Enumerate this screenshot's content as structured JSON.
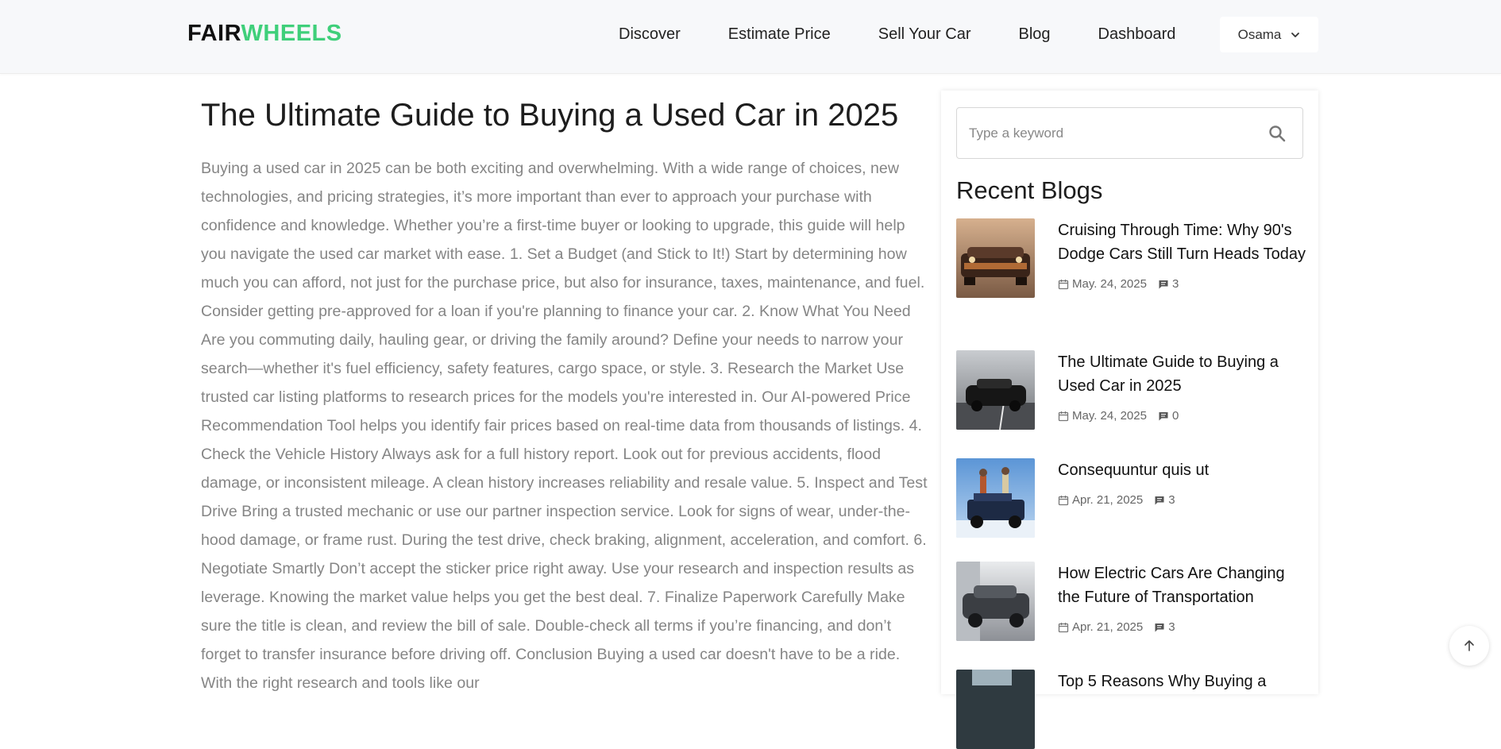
{
  "header": {
    "logo_part1": "FAIR",
    "logo_part2": "WHEELS",
    "nav": [
      "Discover",
      "Estimate Price",
      "Sell Your Car",
      "Blog",
      "Dashboard"
    ],
    "user_name": "Osama"
  },
  "article": {
    "title": "The Ultimate Guide to Buying a Used Car in 2025",
    "body": "Buying a used car in 2025 can be both exciting and overwhelming. With a wide range of choices, new technologies, and pricing strategies, it’s more important than ever to approach your purchase with confidence and knowledge. Whether you’re a first-time buyer or looking to upgrade, this guide will help you navigate the used car market with ease. 1. Set a Budget (and Stick to It!) Start by determining how much you can afford, not just for the purchase price, but also for insurance, taxes, maintenance, and fuel. Consider getting pre-approved for a loan if you're planning to finance your car. 2. Know What You Need Are you commuting daily, hauling gear, or driving the family around? Define your needs to narrow your search—whether it's fuel efficiency, safety features, cargo space, or style. 3. Research the Market Use trusted car listing platforms to research prices for the models you're interested in. Our AI-powered Price Recommendation Tool helps you identify fair prices based on real-time data from thousands of listings. 4. Check the Vehicle History Always ask for a full history report. Look out for previous accidents, flood damage, or inconsistent mileage. A clean history increases reliability and resale value. 5. Inspect and Test Drive Bring a trusted mechanic or use our partner inspection service. Look for signs of wear, under-the-hood damage, or frame rust. During the test drive, check braking, alignment, acceleration, and comfort. 6. Negotiate Smartly Don’t accept the sticker price right away. Use your research and inspection results as leverage. Knowing the market value helps you get the best deal. 7. Finalize Paperwork Carefully Make sure the title is clean, and review the bill of sale. Double-check all terms if you’re financing, and don’t forget to transfer insurance before driving off. Conclusion Buying a used car doesn't have to be a ride. With the right research and tools like our"
  },
  "sidebar": {
    "search_placeholder": "Type a keyword",
    "recent_title": "Recent Blogs",
    "posts": [
      {
        "title": "Cruising Through Time: Why 90's Dodge Cars Still Turn Heads Today",
        "date": "May. 24, 2025",
        "comments": "3"
      },
      {
        "title": "The Ultimate Guide to Buying a Used Car in 2025",
        "date": "May. 24, 2025",
        "comments": "0"
      },
      {
        "title": "Consequuntur quis ut",
        "date": "Apr. 21, 2025",
        "comments": "3"
      },
      {
        "title": "How Electric Cars Are Changing the Future of Transportation",
        "date": "Apr. 21, 2025",
        "comments": "3"
      },
      {
        "title": "Top 5 Reasons Why Buying a",
        "date": "",
        "comments": ""
      }
    ]
  },
  "colors": {
    "brand_green": "#3fcf7a",
    "text_dark": "#1d1d1d",
    "text_muted": "#858585"
  }
}
